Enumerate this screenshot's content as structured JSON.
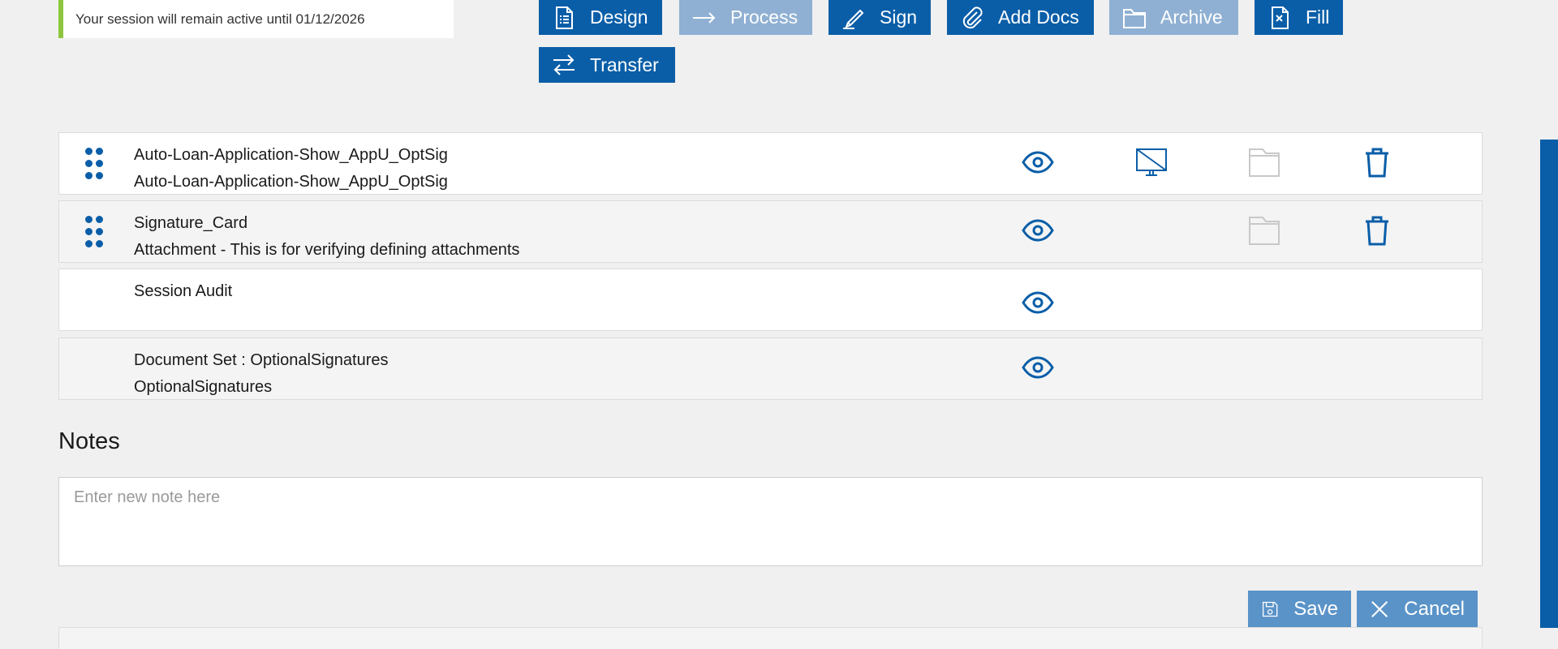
{
  "session": {
    "message": "Your session will remain active until 01/12/2026"
  },
  "toolbar": {
    "design": "Design",
    "process": "Process",
    "sign": "Sign",
    "add_docs": "Add Docs",
    "archive": "Archive",
    "fill": "Fill",
    "transfer": "Transfer"
  },
  "documents": [
    {
      "title": "Auto-Loan-Application-Show_AppU_OptSig",
      "subtitle": "Auto-Loan-Application-Show_AppU_OptSig"
    },
    {
      "title": "Signature_Card",
      "subtitle": "Attachment - This is for verifying defining attachments"
    },
    {
      "title": "Session Audit",
      "subtitle": ""
    },
    {
      "title": "Document Set : OptionalSignatures",
      "subtitle": "OptionalSignatures"
    }
  ],
  "notes": {
    "title": "Notes",
    "placeholder": "Enter new note here"
  },
  "actions": {
    "save": "Save",
    "cancel": "Cancel"
  },
  "colors": {
    "primary": "#0a5ea8",
    "disabled": "#8fb0d3",
    "accent_green": "#8cc63f",
    "action": "#5a93c8"
  }
}
